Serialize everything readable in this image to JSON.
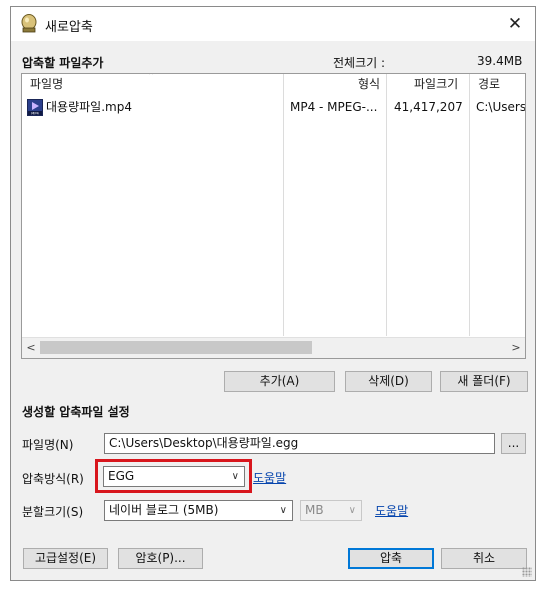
{
  "window": {
    "title": "새로압축"
  },
  "file_list": {
    "heading": "압축할 파일추가",
    "total_size_label": "전체크기 :",
    "total_size_value": "39.4MB",
    "columns": {
      "name": "파일명",
      "type": "형식",
      "size": "파일크기",
      "path": "경로"
    },
    "rows": [
      {
        "name": "대용량파일.mp4",
        "type": "MP4 - MPEG-...",
        "size": "41,417,207",
        "path": "C:\\Users"
      }
    ]
  },
  "list_buttons": {
    "add": "추가(A)",
    "delete": "삭제(D)",
    "new_folder": "새 폴더(F)"
  },
  "settings": {
    "heading": "생성할 압축파일 설정",
    "filename_label": "파일명(N)",
    "filename_value": "C:\\Users\\Desktop\\대용량파일.egg",
    "browse_label": "...",
    "method_label": "압축방식(R)",
    "method_value": "EGG",
    "help_label": "도움말",
    "split_label": "분할크기(S)",
    "split_value": "네이버 블로그 (5MB)",
    "unit_value": "MB",
    "help2_label": "도움말"
  },
  "footer": {
    "advanced": "고급설정(E)",
    "password": "암호(P)...",
    "compress": "압축",
    "cancel": "취소"
  },
  "colors": {
    "highlight": "#d8161d",
    "accent": "#0078d7",
    "link": "#0645ad"
  }
}
